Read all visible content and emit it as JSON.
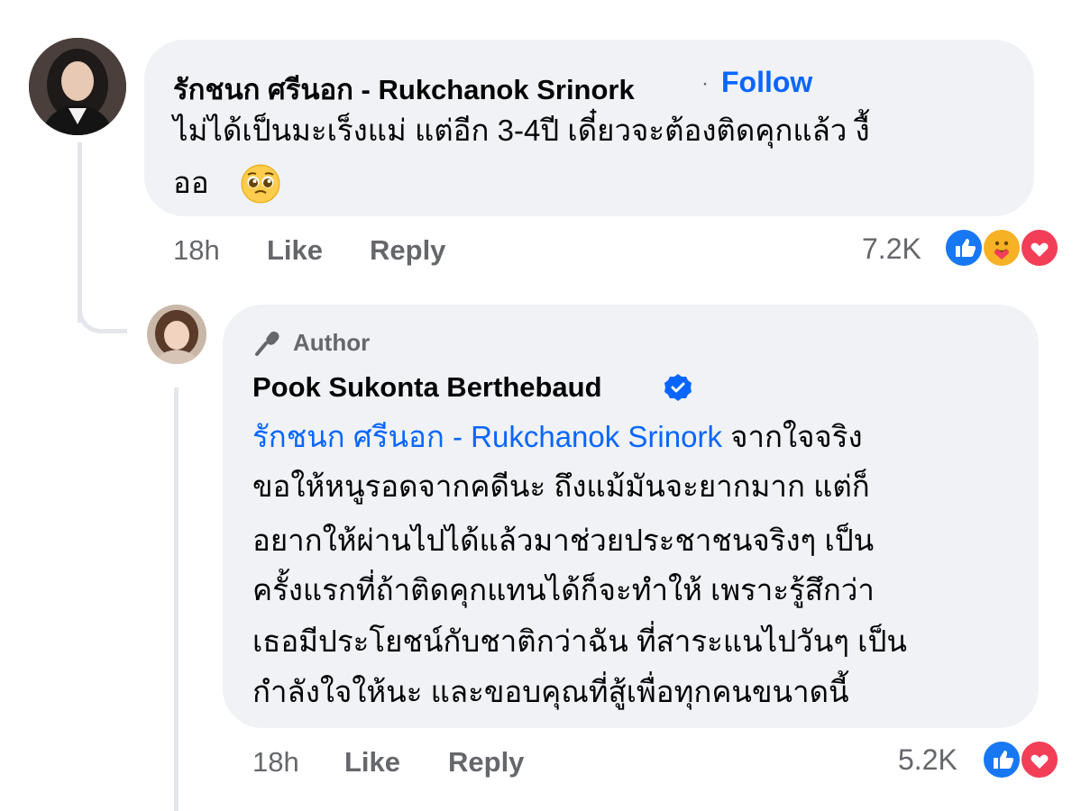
{
  "comment": {
    "author": "รักชนก ศรีนอก - Rukchanok Srinork",
    "separator": "·",
    "follow_label": "Follow",
    "text_line1": "ไม่ได้เป็นมะเร็งแม่ แต่อีก 3-4ปี เดี๋ยวจะต้องติดคุกแล้ว งื้",
    "text_line2": "ออ",
    "emoji": "🥹",
    "time": "18h",
    "like_label": "Like",
    "reply_label": "Reply",
    "reaction_count": "7.2K",
    "reactions": [
      "like-icon",
      "care-icon",
      "love-icon"
    ]
  },
  "reply": {
    "badge_label": "Author",
    "author": "Pook Sukonta Berthebaud",
    "verified": true,
    "mention": "รักชนก ศรีนอก - Rukchanok Srinork",
    "line1_rest": " จากใจจริง",
    "line2": "ขอให้หนูรอดจากคดีนะ ถึงแม้มันจะยากมาก แต่ก็",
    "line3": "อยากให้ผ่านไปได้แล้วมาช่วยประชาชนจริงๆ เป็น",
    "line4": "ครั้งแรกที่ถ้าติดคุกแทนได้ก็จะทำให้ เพราะรู้สึกว่า",
    "line5": "เธอมีประโยชน์กับชาติกว่าฉัน ที่สาระแนไปวันๆ เป็น",
    "line6": "กำลังใจให้นะ และขอบคุณที่สู้เพื่อทุกคนขนาดนี้",
    "time": "18h",
    "like_label": "Like",
    "reply_label": "Reply",
    "reaction_count": "5.2K",
    "reactions": [
      "like-icon",
      "love-icon"
    ]
  },
  "colors": {
    "accent": "#0866ff",
    "bubble": "#f0f2f5",
    "meta": "#65676b",
    "love": "#f33e58",
    "care": "#f7b125"
  }
}
